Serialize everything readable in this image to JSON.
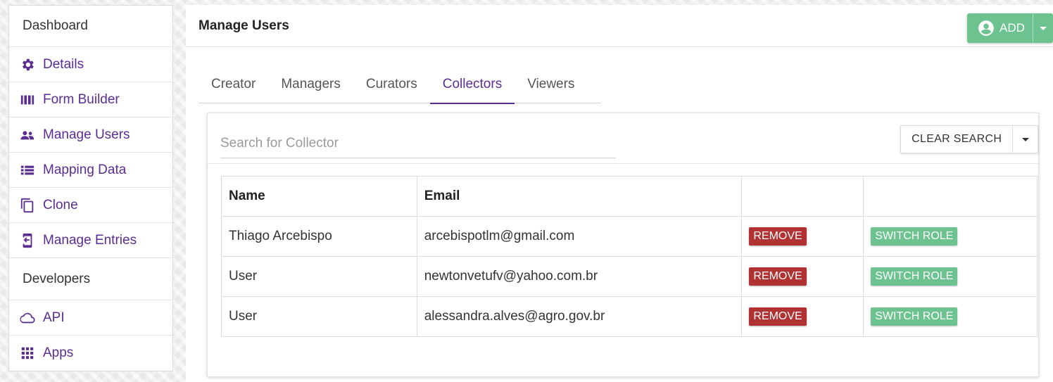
{
  "sidebar": {
    "dashboard_label": "Dashboard",
    "items": [
      {
        "label": "Details",
        "icon": "gear-icon"
      },
      {
        "label": "Form Builder",
        "icon": "form-builder-icon"
      },
      {
        "label": "Manage Users",
        "icon": "users-icon"
      },
      {
        "label": "Mapping Data",
        "icon": "list-icon"
      },
      {
        "label": "Clone",
        "icon": "clone-icon"
      },
      {
        "label": "Manage Entries",
        "icon": "entries-icon"
      }
    ],
    "developers_label": "Developers",
    "dev_items": [
      {
        "label": "API",
        "icon": "cloud-icon"
      },
      {
        "label": "Apps",
        "icon": "apps-grid-icon"
      }
    ]
  },
  "main": {
    "title": "Manage Users",
    "add_label": "ADD",
    "tabs": [
      {
        "label": "Creator"
      },
      {
        "label": "Managers"
      },
      {
        "label": "Curators"
      },
      {
        "label": "Collectors",
        "active": true
      },
      {
        "label": "Viewers"
      }
    ],
    "search": {
      "placeholder": "Search for Collector",
      "value": ""
    },
    "clear_label": "CLEAR SEARCH",
    "table": {
      "headers": [
        "Name",
        "Email",
        "",
        ""
      ],
      "rows": [
        {
          "name": "Thiago Arcebispo",
          "email": "arcebispotlm@gmail.com",
          "remove": "REMOVE",
          "switch": "SWITCH ROLE"
        },
        {
          "name": "User",
          "email": "newtonvetufv@yahoo.com.br",
          "remove": "REMOVE",
          "switch": "SWITCH ROLE"
        },
        {
          "name": "User",
          "email": "alessandra.alves@agro.gov.br",
          "remove": "REMOVE",
          "switch": "SWITCH ROLE"
        }
      ]
    }
  },
  "colors": {
    "accent": "#5c2d91",
    "success": "#6cc38f",
    "danger": "#b13232"
  }
}
